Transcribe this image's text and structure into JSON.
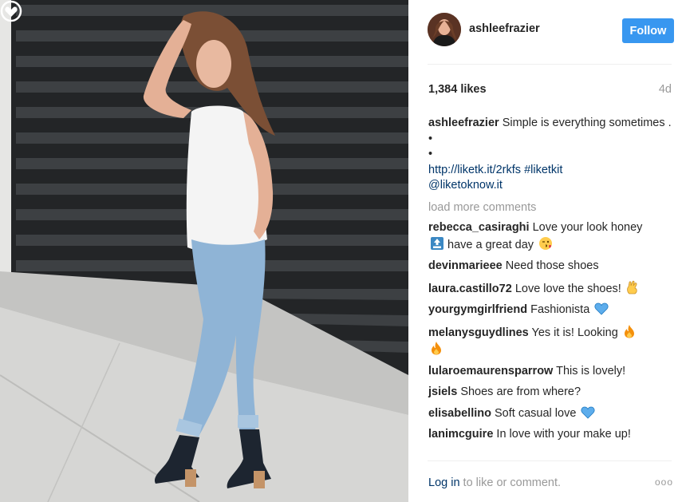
{
  "post": {
    "username": "ashleefrazier",
    "follow_label": "Follow",
    "likes": "1,384 likes",
    "age": "4d",
    "caption_text": "Simple is everything sometimes .",
    "bullet1": "•",
    "bullet2": "•",
    "link": "http://liketk.it/2rkfs",
    "hashtag": "#liketkit",
    "mention": "@liketoknow.it",
    "load_more": "load more comments",
    "login_link": "Log in",
    "login_rest": "to like or comment.",
    "more_dots": "ooo"
  },
  "comments": [
    {
      "user": "rebecca_casiraghi",
      "text": "Love your look honey",
      "text2": "have a great day",
      "emoji": "top-icon",
      "emoji2": "wink-kiss-icon"
    },
    {
      "user": "devinmarieee",
      "text": "Need those shoes"
    },
    {
      "user": "laura.castillo72",
      "text": "Love love the shoes!",
      "emoji": "ok-hand-icon"
    },
    {
      "user": "yourgymgirlfriend",
      "text": "Fashionista",
      "emoji": "blue-heart-icon"
    },
    {
      "user": "melanysguydlines",
      "text": "Yes it is! Looking",
      "emoji": "fire-icon"
    },
    {
      "user": "lularoemaurensparrow",
      "text": "This is lovely!"
    },
    {
      "user": "jsiels",
      "text": "Shoes are from where?"
    },
    {
      "user": "elisabellino",
      "text": "Soft casual love",
      "emoji": "blue-heart-icon"
    },
    {
      "user": "lanimcguire",
      "text": "In love with your make up!"
    }
  ]
}
